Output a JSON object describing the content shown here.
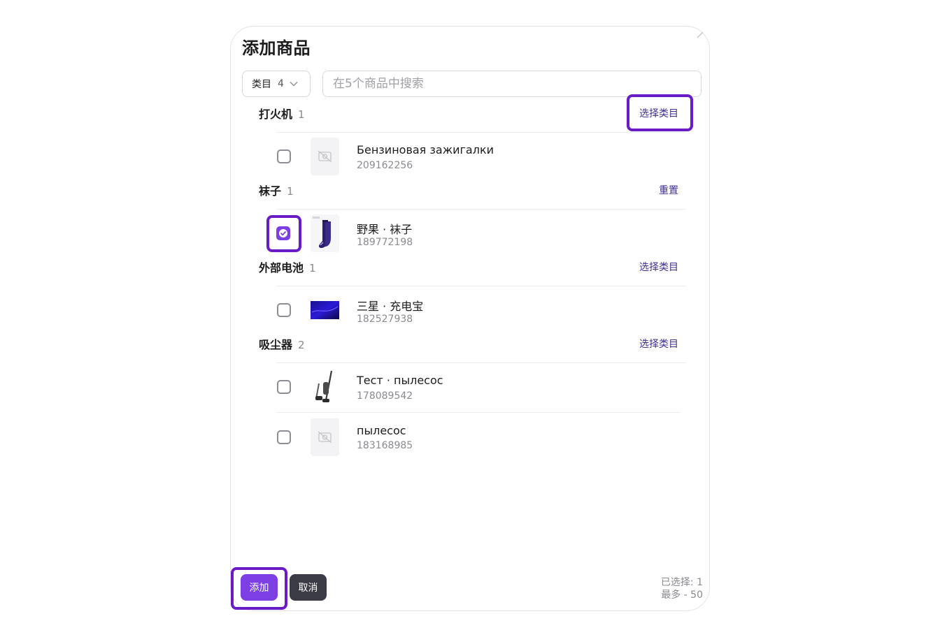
{
  "dialog": {
    "title": "添加商品",
    "filter": {
      "label": "类目",
      "count": "4"
    },
    "search": {
      "placeholder": "在5个商品中搜索",
      "value": ""
    }
  },
  "categories": [
    {
      "name": "打火机",
      "count": "1",
      "action": "选择类目",
      "items": [
        {
          "name": "Бензиновая зажигалки",
          "id": "209162256",
          "checked": false,
          "thumb": "no-image-icon"
        }
      ]
    },
    {
      "name": "袜子",
      "count": "1",
      "action": "重置",
      "items": [
        {
          "name": "野果 · 袜子",
          "id": "189772198",
          "checked": true,
          "thumb": "sock-image"
        }
      ]
    },
    {
      "name": "外部电池",
      "count": "1",
      "action": "选择类目",
      "items": [
        {
          "name": "三星 · 充电宝",
          "id": "182527938",
          "checked": false,
          "thumb": "powerbank-image"
        }
      ]
    },
    {
      "name": "吸尘器",
      "count": "2",
      "action": "选择类目",
      "items": [
        {
          "name": "Тест · пылесос",
          "id": "178089542",
          "checked": false,
          "thumb": "vacuum-image"
        },
        {
          "name": "пылесос",
          "id": "183168985",
          "checked": false,
          "thumb": "no-image-icon"
        }
      ]
    }
  ],
  "footer": {
    "add_label": "添加",
    "cancel_label": "取消",
    "selected": "已选择: 1",
    "max": "最多 - 50"
  },
  "colors": {
    "accent": "#7b3fe4",
    "highlight": "#6a1bc6",
    "link": "#3d2f8f",
    "cancel": "#3b3b45"
  }
}
